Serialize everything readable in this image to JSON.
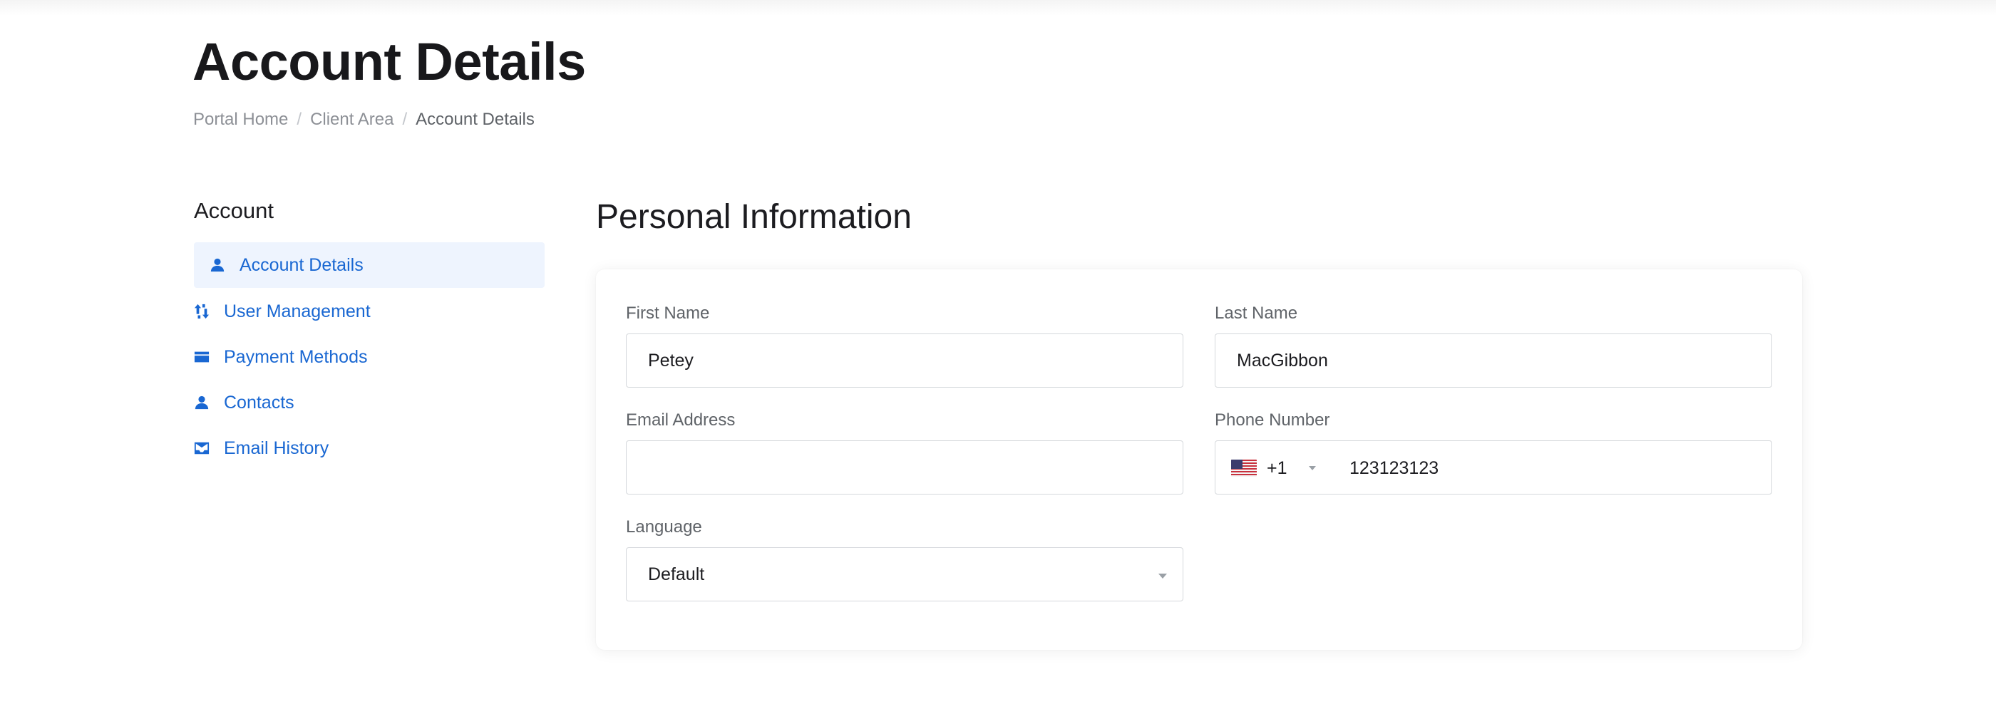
{
  "page": {
    "title": "Account Details"
  },
  "breadcrumb": [
    {
      "label": "Portal Home"
    },
    {
      "label": "Client Area"
    },
    {
      "label": "Account Details"
    }
  ],
  "sidebar": {
    "heading": "Account",
    "items": [
      {
        "label": "Account Details",
        "icon": "person-icon",
        "active": true
      },
      {
        "label": "User Management",
        "icon": "sort-arrows-icon",
        "active": false
      },
      {
        "label": "Payment Methods",
        "icon": "credit-card-icon",
        "active": false
      },
      {
        "label": "Contacts",
        "icon": "person-icon",
        "active": false
      },
      {
        "label": "Email History",
        "icon": "envelope-icon",
        "active": false
      }
    ]
  },
  "personal_info": {
    "title": "Personal Information",
    "first_name": {
      "label": "First Name",
      "value": "Petey"
    },
    "last_name": {
      "label": "Last Name",
      "value": "MacGibbon"
    },
    "email": {
      "label": "Email Address",
      "value": ""
    },
    "phone": {
      "label": "Phone Number",
      "country": "US",
      "dial_code": "+1",
      "number": "123123123"
    },
    "language": {
      "label": "Language",
      "selected": "Default"
    }
  },
  "colors": {
    "accent": "#1967d2",
    "active_bg": "#eef4fe"
  }
}
